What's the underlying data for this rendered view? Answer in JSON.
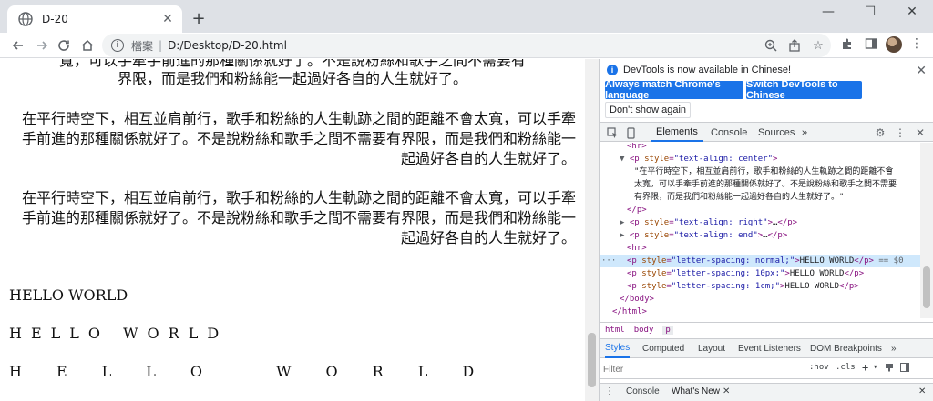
{
  "browser": {
    "tab_title": "D-20",
    "tab_close": "✕",
    "new_tab": "+",
    "window_controls": [
      "—",
      "☐",
      "✕"
    ],
    "address": {
      "scheme_label": "檔案",
      "separator": "|",
      "url": "D:/Desktop/D-20.html"
    }
  },
  "page": {
    "cut_line_1": "寬，可以手牽手前進的那種關係就好了。不是說粉絲和歌手之間不需要有",
    "cut_line_2": "界限，而是我們和粉絲能一起過好各自的人生就好了。",
    "para_right": "在平行時空下，相互並肩前行，歌手和粉絲的人生軌跡之間的距離不會太寬，可以手牽手前進的那種關係就好了。不是說粉絲和歌手之間不需要有界限，而是我們和粉絲能一起過好各自的人生就好了。",
    "para_end": "在平行時空下，相互並肩前行，歌手和粉絲的人生軌跡之間的距離不會太寬，可以手牽手前進的那種關係就好了。不是說粉絲和歌手之間不需要有界限，而是我們和粉絲能一起過好各自的人生就好了。",
    "hello_normal": "HELLO WORLD",
    "hello_10px": "HELLO WORLD",
    "hello_1cm": "HELLO WORLD"
  },
  "devtools": {
    "banner_msg": "DevTools is now available in Chinese!",
    "btn_match": "Always match Chrome's language",
    "btn_switch": "Switch DevTools to Chinese",
    "btn_dont_show": "Don't show again",
    "tabs": [
      "Elements",
      "Console",
      "Sources",
      "»"
    ],
    "dom": {
      "hr1": "<hr>",
      "p_center_open": "<p",
      "p_center_attr": "style",
      "p_center_val": "\"text-align: center\"",
      "p_center_text_1": "\"在平行時空下，相互並肩前行，歌手和粉絲的人生軌跡之間的距離不會",
      "p_center_text_2": "太寬，可以手牽手前進的那種關係就好了。不是說粉絲和歌手之間不需要",
      "p_center_text_3": "有界限，而是我們和粉絲能一起過好各自的人生就好了。\"",
      "p_close": "</p>",
      "p_right_val": "\"text-align: right\"",
      "p_end_val": "\"text-align: end\"",
      "ellipsis": "…",
      "hr2": "<hr>",
      "p_ls_normal_val": "\"letter-spacing: normal;\"",
      "p_ls_10_val": "\"letter-spacing: 10px;\"",
      "p_ls_1cm_val": "\"letter-spacing: 1cm;\"",
      "hello_text": "HELLO WORLD",
      "sel_marker": "== $0",
      "body_close": "</body>",
      "html_close": "</html>"
    },
    "breadcrumbs": [
      "html",
      "body",
      "p"
    ],
    "sub_tabs": [
      "Styles",
      "Computed",
      "Layout",
      "Event Listeners",
      "DOM Breakpoints",
      "»"
    ],
    "filter_placeholder": "Filter",
    "filter_hov": ":hov",
    "filter_cls": ".cls",
    "drawer_console": "Console",
    "drawer_whats_new": "What's New",
    "drawer_close": "✕"
  }
}
